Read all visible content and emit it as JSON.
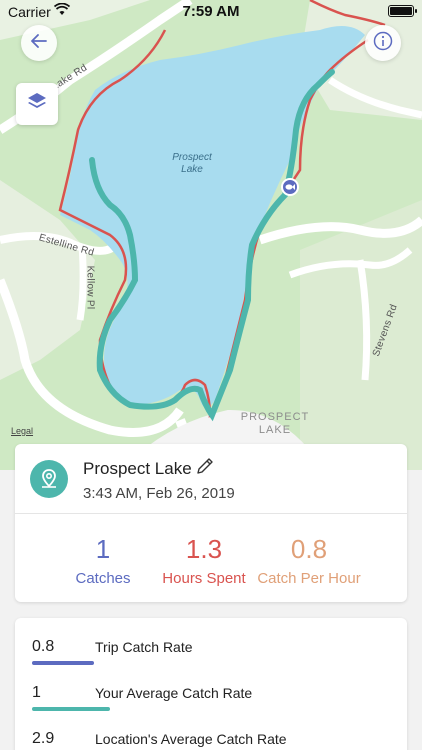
{
  "status": {
    "carrier": "Carrier",
    "time": "7:59 AM"
  },
  "map": {
    "roads": {
      "lake_rd": "Lake Rd",
      "estelline": "Estelline Rd",
      "kellow": "Kellow Pl",
      "stevens": "Stevens Rd"
    },
    "lake_name_line1": "Prospect",
    "lake_name_line2": "Lake",
    "lake_name_upper_1": "PROSPECT",
    "lake_name_upper_2": "LAKE",
    "legal": "Legal",
    "colors": {
      "water": "#a8dcef",
      "land": "#cfe9c4",
      "track_teal": "#4db6ac",
      "track_red": "#d9534f",
      "marker": "#5c6bc0"
    }
  },
  "location": {
    "name": "Prospect Lake",
    "timestamp": "3:43 AM, Feb 26, 2019"
  },
  "stats": [
    {
      "value": "1",
      "label": "Catches",
      "color": "#5c6bc0"
    },
    {
      "value": "1.3",
      "label": "Hours Spent",
      "color": "#d9534f"
    },
    {
      "value": "0.8",
      "label": "Catch Per Hour",
      "color": "#e0a078"
    }
  ],
  "rates": [
    {
      "value": "0.8",
      "label": "Trip Catch Rate",
      "color": "#5c6bc0",
      "fraction": 0.8
    },
    {
      "value": "1",
      "label": "Your Average Catch Rate",
      "color": "#4db6ac",
      "fraction": 1.0
    },
    {
      "value": "2.9",
      "label": "Location's Average Catch Rate",
      "color": "#e0a078",
      "fraction": 2.9
    }
  ]
}
